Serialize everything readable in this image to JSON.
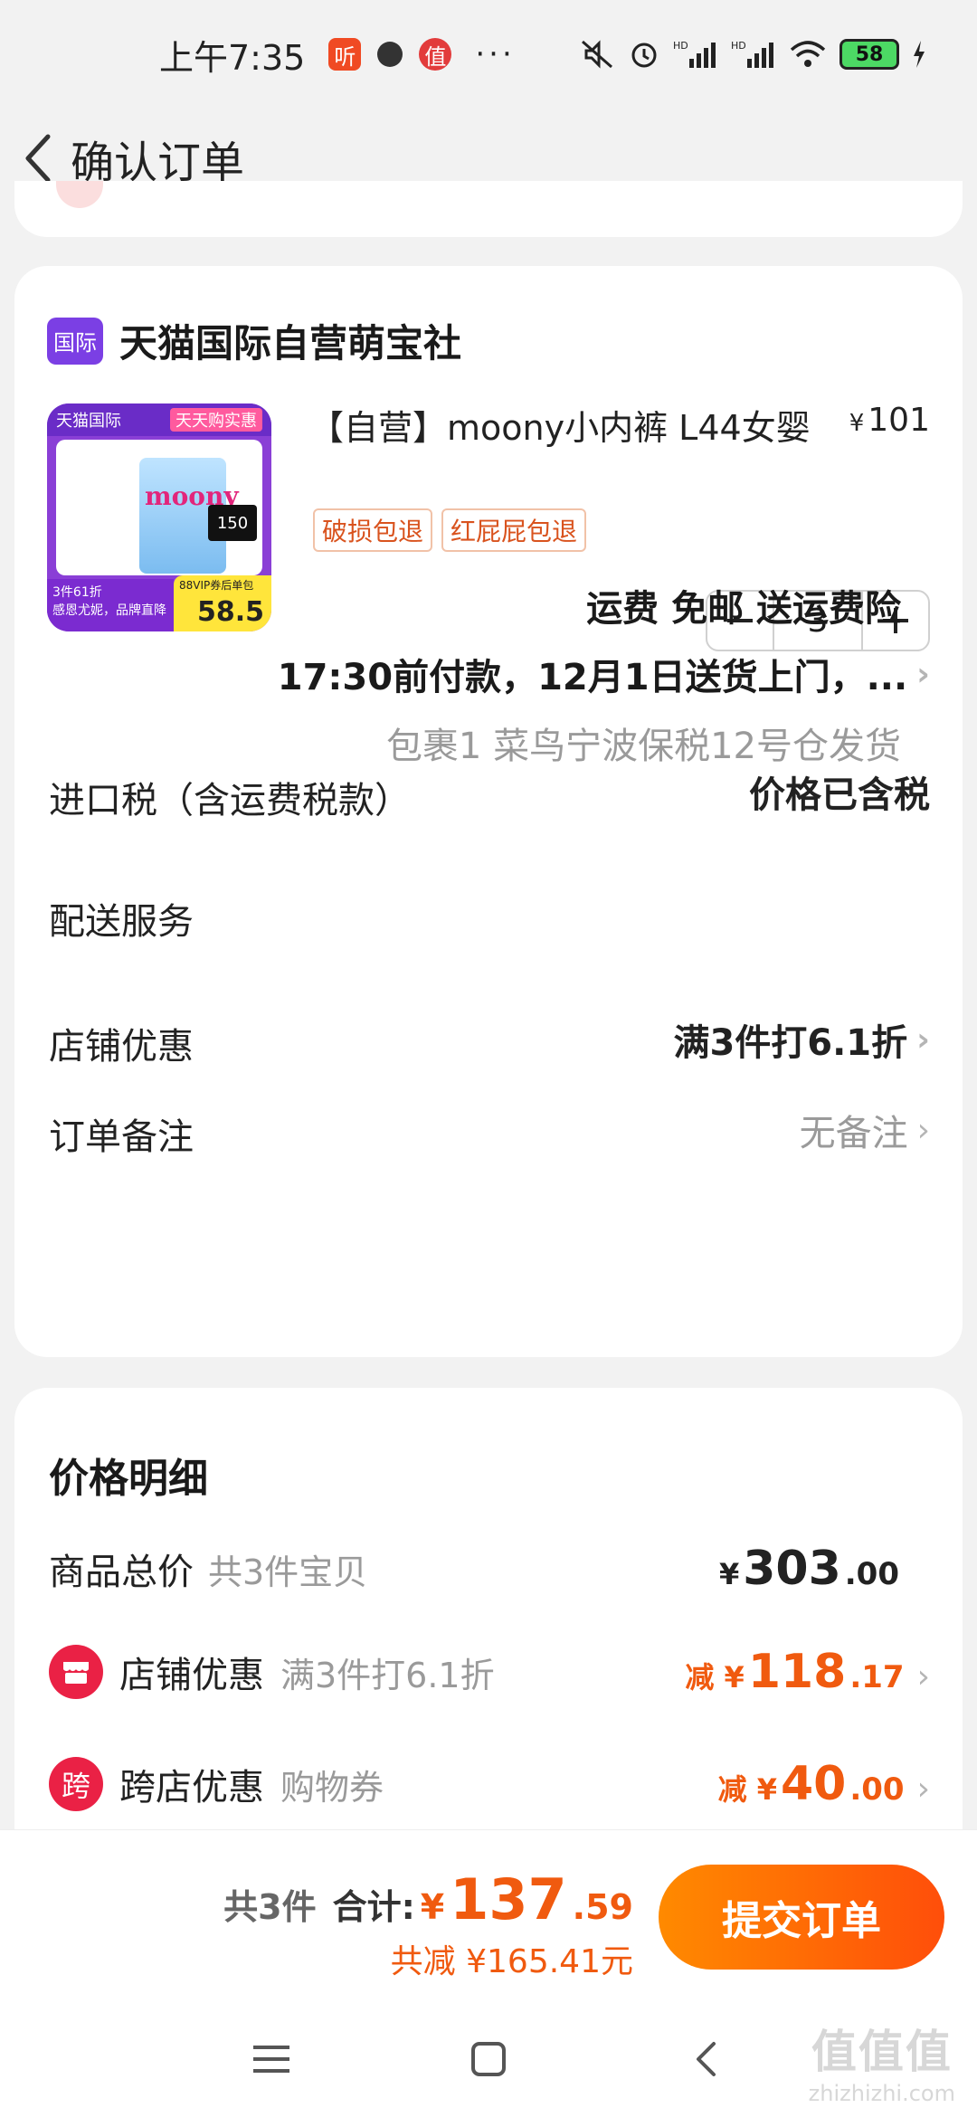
{
  "status_bar": {
    "time": "上午7:35",
    "badges": [
      "听",
      "",
      "值"
    ],
    "more": "···",
    "battery": "58"
  },
  "header": {
    "title": "确认订单"
  },
  "store": {
    "logo_text": "国际",
    "name": "天猫国际自营萌宝社",
    "product": {
      "title": "【自营】moony小内裤 L44女婴",
      "price_symbol": "¥",
      "price": "101",
      "image_text": {
        "top_left": "天猫国际",
        "top_tag": "天天购实惠",
        "brand": "moony",
        "count": "150",
        "promo_left": "3件61折",
        "promo_left_bottom": "感恩尤妮，品牌直降",
        "promo_right_small": "88VIP券后单包",
        "promo_right_big": "58.5"
      },
      "tags": [
        "破损包退",
        "红屁屁包退"
      ],
      "quantity": "3"
    },
    "rows": {
      "tax_label": "进口税（含运费税款）",
      "tax_value": "价格已含税",
      "shipping_label": "配送服务",
      "shipping_line1": "运费 免邮 送运费险",
      "shipping_line2": "17:30前付款，12月1日送货上门，...",
      "shipping_line3": "包裹1 菜鸟宁波保税12号仓发货",
      "discount_label": "店铺优惠",
      "discount_value": "满3件打6.1折",
      "note_label": "订单备注",
      "note_value": "无备注"
    }
  },
  "price_detail": {
    "title": "价格明细",
    "total_label": "商品总价",
    "total_sub": "共3件宝贝",
    "total_yen": "¥",
    "total_int": "303",
    "total_dec": ".00",
    "store_discount_icon": "",
    "store_discount_label": "店铺优惠",
    "store_discount_sub": "满3件打6.1折",
    "store_discount_prefix": "减 ¥",
    "store_discount_int": "118",
    "store_discount_dec": ".17",
    "cross_icon": "跨",
    "cross_label": "跨店优惠",
    "cross_sub": "购物券",
    "cross_prefix": "减 ¥",
    "cross_int": "40",
    "cross_dec": ".00"
  },
  "bottom": {
    "count": "共3件",
    "sum_label": "合计:",
    "sum_yen": "¥",
    "sum_int": "137",
    "sum_dec": ".59",
    "saved": "共减 ¥165.41元",
    "submit": "提交订单"
  },
  "watermark": {
    "big": "值值值",
    "small": "zhizhizhi.com"
  },
  "colors": {
    "accent": "#f05a0f",
    "brand_purple": "#7b3fe4",
    "tag_red": "#ea2145"
  }
}
